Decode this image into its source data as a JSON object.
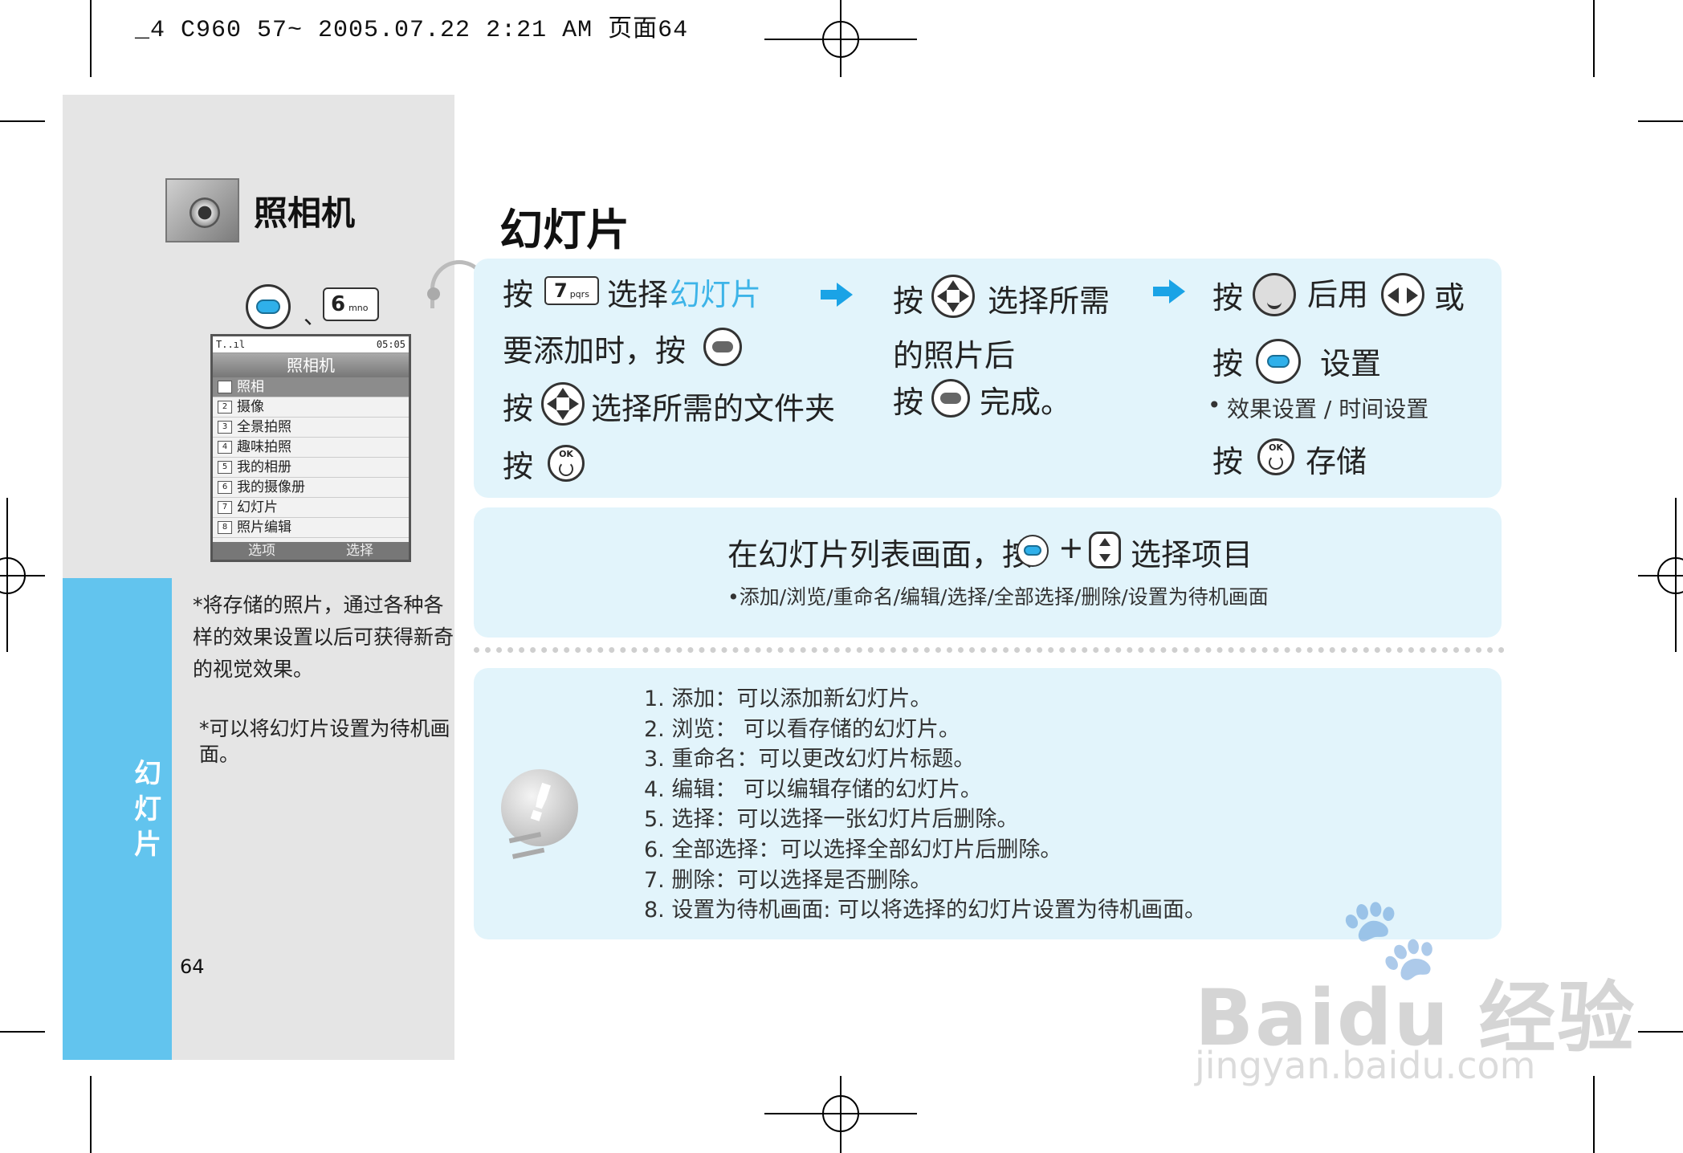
{
  "print_header": "_4 C960 57~ 2005.07.22 2:21 AM 页面64",
  "sidebar": {
    "section_title": "照相机",
    "strip_title": "幻灯片",
    "key_separator": "、",
    "key_6_label": "6",
    "key_6_sub": "mno",
    "phone_screen": {
      "status_left": "T..ıl",
      "status_right": "05:05",
      "title": "照相机",
      "menu_items": [
        {
          "num": "1",
          "label": "照相"
        },
        {
          "num": "2",
          "label": "摄像"
        },
        {
          "num": "3",
          "label": "全景拍照"
        },
        {
          "num": "4",
          "label": "趣味拍照"
        },
        {
          "num": "5",
          "label": "我的相册"
        },
        {
          "num": "6",
          "label": "我的摄像册"
        },
        {
          "num": "7",
          "label": "幻灯片"
        },
        {
          "num": "8",
          "label": "照片编辑"
        }
      ],
      "softkey_left": "选项",
      "softkey_right": "选择"
    },
    "note1": "将存储的照片，通过各种各样的效果设置以后可获得新奇的视觉效果。",
    "note2": "可以将幻灯片设置为待机画面。",
    "note_bullet": "*",
    "page_number": "64"
  },
  "main": {
    "title": "幻灯片",
    "press": "按",
    "step1": {
      "key7_label": "7",
      "key7_sub": "pqrs",
      "select_text": "选择",
      "highlight": "幻灯片",
      "add_text": "要添加时，按",
      "select_folder": "选择所需的文件夹"
    },
    "step2": {
      "select_needed": "选择所需",
      "after_photo": "的照片后",
      "complete": "完成。"
    },
    "step3": {
      "then_use": "后用",
      "or": "或",
      "settings": "设置",
      "bullet": "•",
      "sub_note": "效果设置 / 时间设置",
      "save": "存储"
    },
    "list_panel": {
      "line": "在幻灯片列表画面，按",
      "plus": "+",
      "choose_item": "选择项目",
      "options": "•添加/浏览/重命名/编辑/选择/全部选择/删除/设置为待机画面"
    },
    "tips": [
      "1. 添加：可以添加新幻灯片。",
      "2. 浏览： 可以看存储的幻灯片。",
      "3. 重命名：可以更改幻灯片标题。",
      "4. 编辑：  可以编辑存储的幻灯片。",
      "5. 选择：可以选择一张幻灯片后删除。",
      "6. 全部选择：可以选择全部幻灯片后删除。",
      "7. 删除：可以选择是否删除。",
      "8. 设置为待机画面:  可以将选择的幻灯片设置为待机画面。"
    ],
    "ok_label": "OK",
    "bulb_mark": "!"
  },
  "watermark": {
    "brand": "Baidu 经验",
    "url": "jingyan.baidu.com",
    "paw_icon": "paw-icon"
  },
  "colors": {
    "accent_blue": "#62c4ee",
    "panel_bg": "#e2f4fb",
    "highlight_text": "#3db4e8",
    "arrow": "#1aa3e6"
  }
}
